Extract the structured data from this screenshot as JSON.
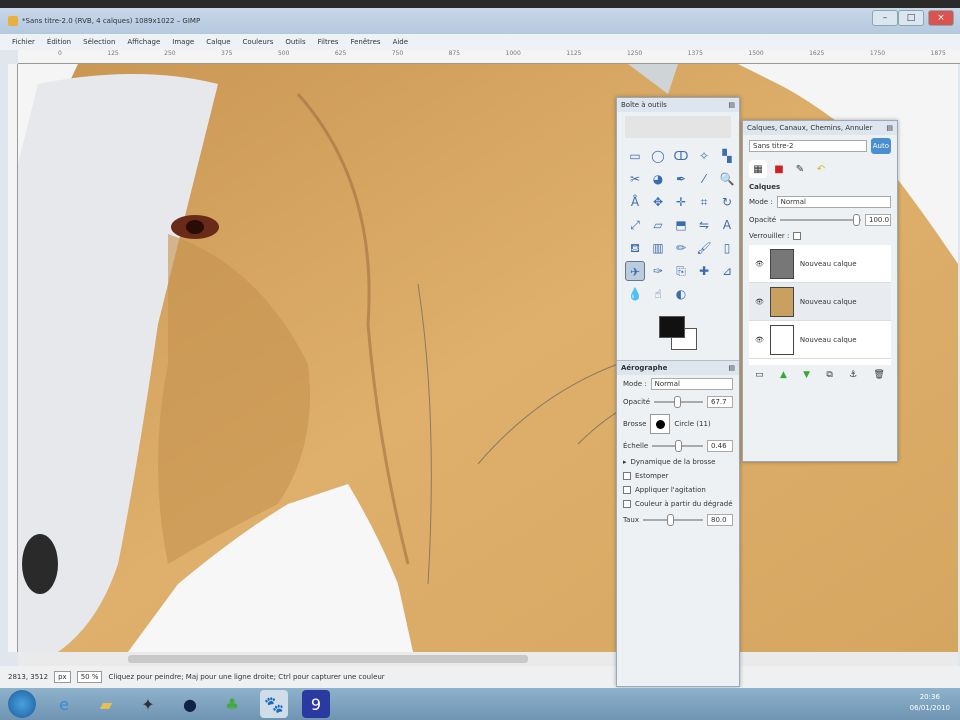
{
  "window": {
    "title": "*Sans titre-2.0 (RVB, 4 calques) 1089x1022 – GIMP"
  },
  "menu": [
    "Fichier",
    "Édition",
    "Sélection",
    "Affichage",
    "Image",
    "Calque",
    "Couleurs",
    "Outils",
    "Filtres",
    "Fenêtres",
    "Aide"
  ],
  "ruler": [
    "0",
    "125",
    "250",
    "375",
    "500",
    "625",
    "750",
    "875",
    "1000",
    "1125",
    "1250",
    "1375",
    "1500",
    "1625",
    "1750",
    "1875"
  ],
  "toolbox": {
    "title": "Boîte à outils"
  },
  "layers_panel": {
    "title": "Calques, Canaux, Chemins, Annuler",
    "image": "Sans titre-2",
    "auto": "Auto",
    "section": "Calques",
    "mode_label": "Mode :",
    "mode": "Normal",
    "opacity_label": "Opacité",
    "opacity": "100.0",
    "lock_label": "Verrouiller :",
    "layers": [
      "Nouveau calque",
      "Nouveau calque",
      "Nouveau calque"
    ]
  },
  "tool_options": {
    "title": "Aérographe",
    "mode_label": "Mode :",
    "mode": "Normal",
    "opacity_label": "Opacité",
    "opacity": "67.7",
    "brush_label": "Brosse",
    "brush": "Circle (11)",
    "scale_label": "Échelle",
    "scale": "0.46",
    "dynamics": "Dynamique de la brosse",
    "fade": "Estomper",
    "jitter": "Appliquer l'agitation",
    "gradient": "Couleur à partir du dégradé",
    "rate_label": "Taux",
    "rate": "80.0"
  },
  "status": {
    "coords": "2813, 3512",
    "unit": "px",
    "zoom": "50 %",
    "message": "Cliquez pour peindre; Maj pour une ligne droite; Ctrl pour capturer une couleur"
  },
  "tray": {
    "time": "20:36",
    "date": "06/01/2010"
  }
}
